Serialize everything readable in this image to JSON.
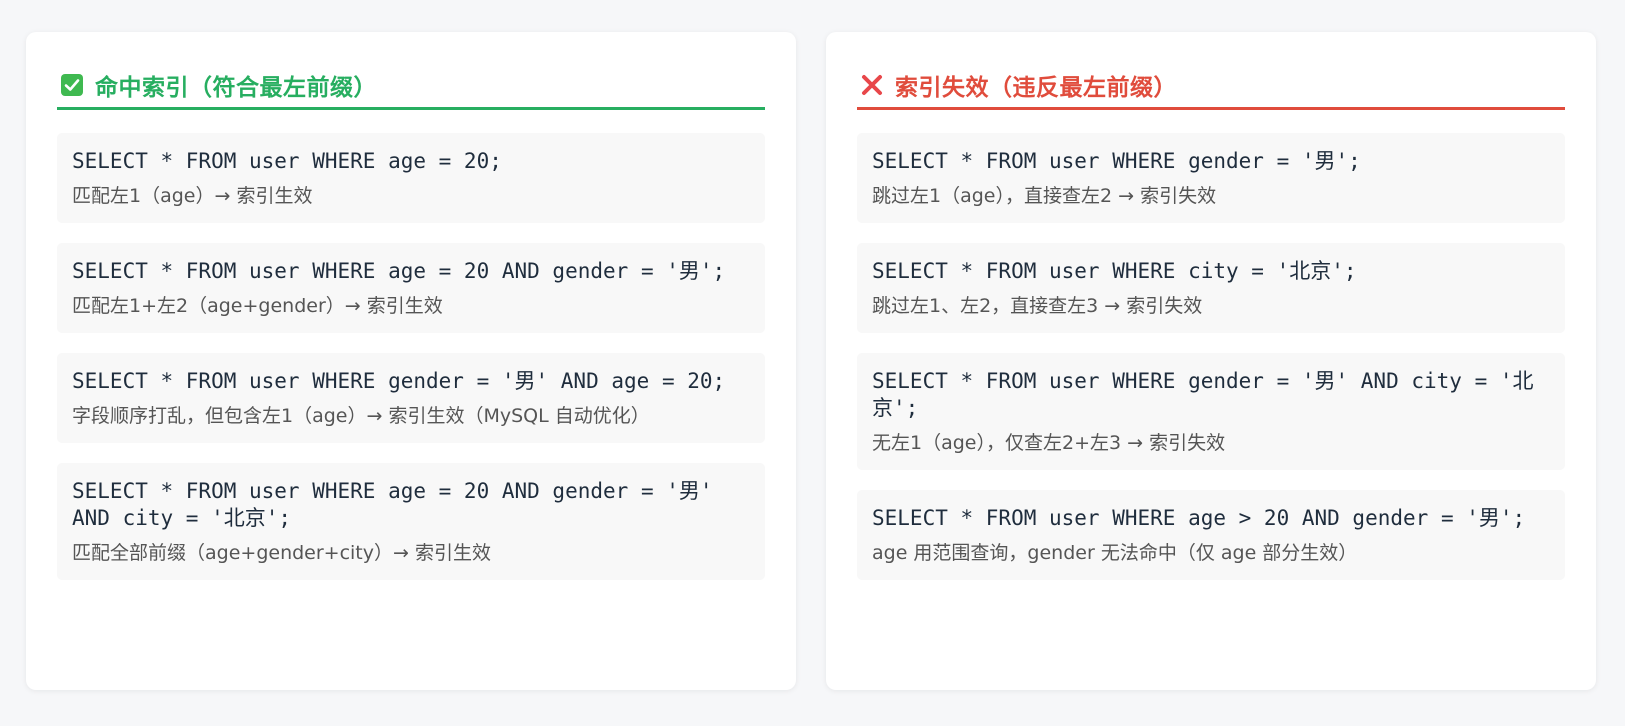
{
  "left": {
    "title": "命中索引（符合最左前缀）",
    "icon": "check-box-icon",
    "accent": "#27ae60",
    "items": [
      {
        "code": "SELECT * FROM user WHERE age = 20;",
        "desc": "匹配左1（age）→ 索引生效"
      },
      {
        "code": "SELECT * FROM user WHERE age = 20 AND gender = '男';",
        "desc": "匹配左1+左2（age+gender）→ 索引生效"
      },
      {
        "code": "SELECT * FROM user WHERE gender = '男' AND age = 20;",
        "desc": "字段顺序打乱，但包含左1（age）→ 索引生效（MySQL 自动优化）"
      },
      {
        "code": "SELECT * FROM user WHERE age = 20 AND gender = '男' AND city = '北京';",
        "desc": "匹配全部前缀（age+gender+city）→ 索引生效"
      }
    ]
  },
  "right": {
    "title": "索引失效（违反最左前缀）",
    "icon": "cross-mark-icon",
    "accent": "#e04c3c",
    "items": [
      {
        "code": "SELECT * FROM user WHERE gender = '男';",
        "desc": "跳过左1（age），直接查左2 → 索引失效"
      },
      {
        "code": "SELECT * FROM user WHERE city = '北京';",
        "desc": "跳过左1、左2，直接查左3 → 索引失效"
      },
      {
        "code": "SELECT * FROM user WHERE gender = '男' AND city = '北京';",
        "desc": "无左1（age），仅查左2+左3 → 索引失效"
      },
      {
        "code": "SELECT * FROM user WHERE age > 20 AND gender = '男';",
        "desc": "age 用范围查询，gender 无法命中（仅 age 部分生效）"
      }
    ]
  }
}
